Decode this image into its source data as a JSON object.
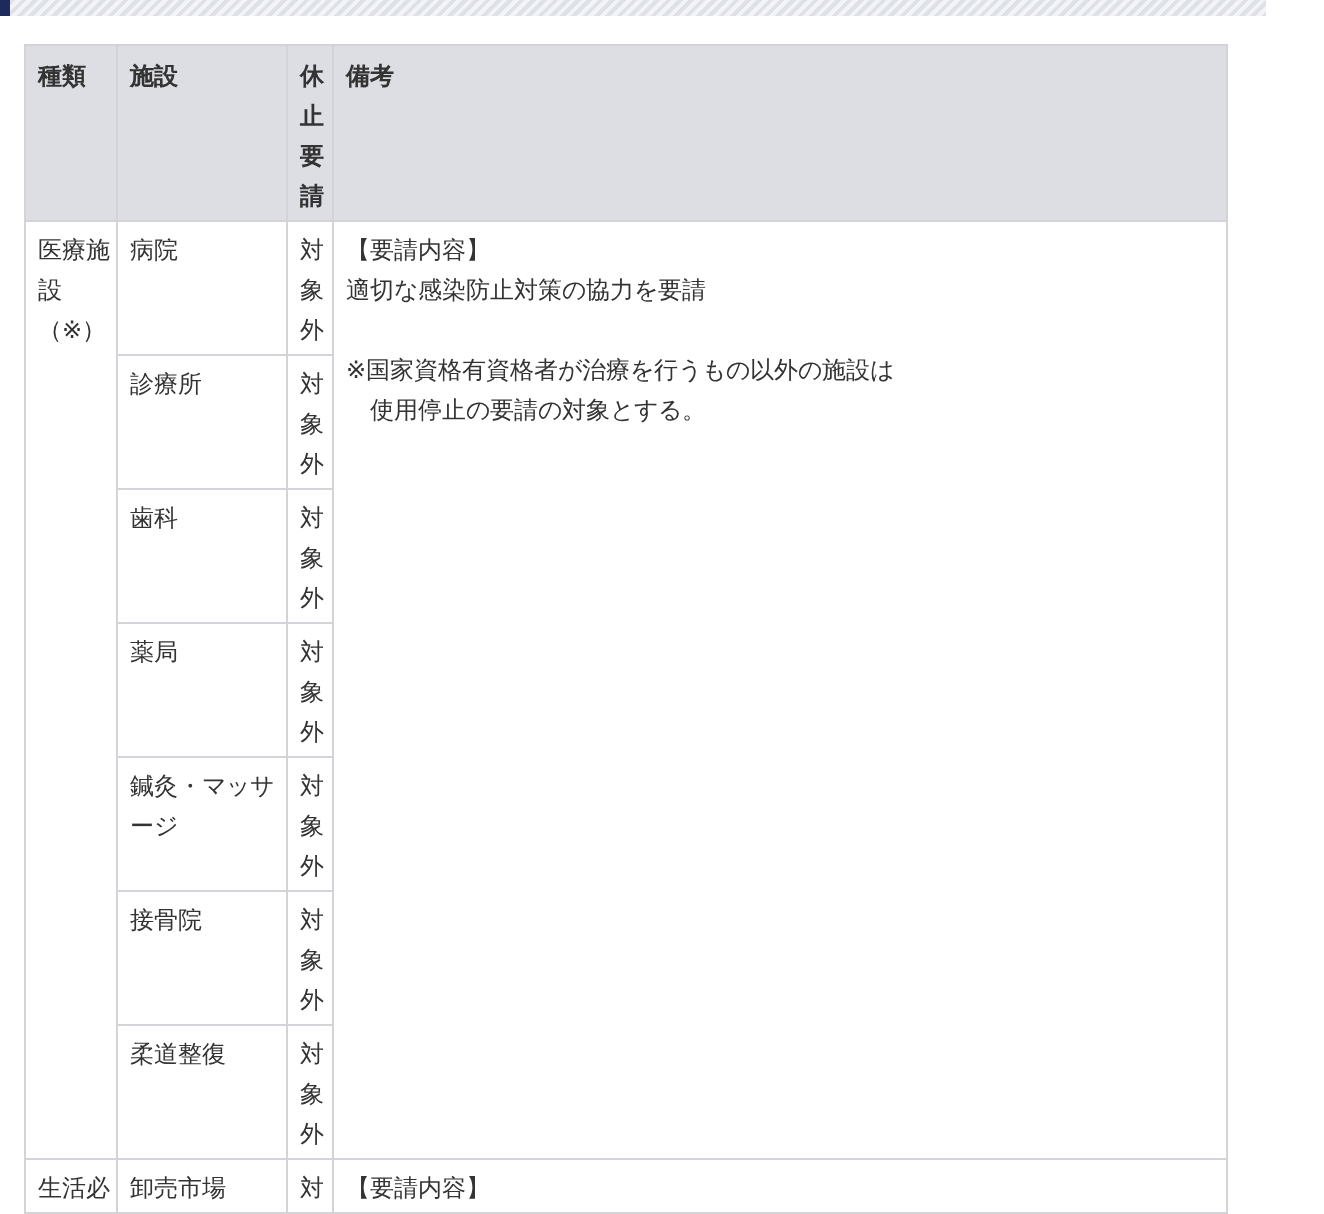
{
  "table": {
    "columns": [
      "種類",
      "施設",
      "休止要請",
      "備考"
    ],
    "groups": [
      {
        "category": "医療施設（※）",
        "facilities": [
          {
            "name": "病院",
            "status": "対象外"
          },
          {
            "name": "診療所",
            "status": "対象外"
          },
          {
            "name": "歯科",
            "status": "対象外"
          },
          {
            "name": "薬局",
            "status": "対象外"
          },
          {
            "name": "鍼灸・マッサージ",
            "status": "対象外"
          },
          {
            "name": "接骨院",
            "status": "対象外"
          },
          {
            "name": "柔道整復",
            "status": "対象外"
          }
        ],
        "remarks": {
          "heading": "【要請内容】",
          "request": "適切な感染防止対策の協力を要請",
          "note": [
            "※国家資格有資格者が治療を行うもの以外の施設は",
            "使用停止の要請の対象とする。"
          ]
        }
      },
      {
        "category": "生活必",
        "facilities": [
          {
            "name": "卸売市場",
            "status": "対"
          }
        ],
        "remarks": {
          "heading": "【要請内容】"
        }
      }
    ]
  }
}
